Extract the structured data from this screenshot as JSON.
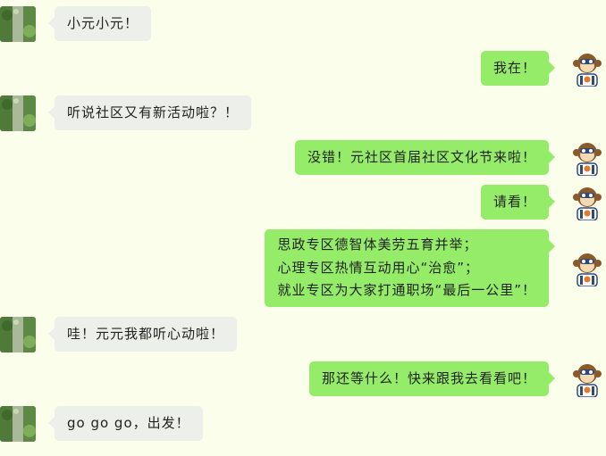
{
  "conversation": {
    "messages": [
      {
        "side": "left",
        "sender": "other",
        "text": "小元小元！"
      },
      {
        "side": "right",
        "sender": "self",
        "text": "我在！"
      },
      {
        "side": "left",
        "sender": "other",
        "text": "听说社区又有新活动啦？！"
      },
      {
        "side": "right",
        "sender": "self",
        "text": "没错！元社区首届社区文化节来啦！"
      },
      {
        "side": "right",
        "sender": "self",
        "text": "请看！"
      },
      {
        "side": "right",
        "sender": "self",
        "lines": [
          "思政专区德智体美劳五育并举；",
          "心理专区热情互动用心“治愈”；",
          "就业专区为大家打通职场“最后一公里”！"
        ]
      },
      {
        "side": "left",
        "sender": "other",
        "text": "哇！元元我都听心动啦！"
      },
      {
        "side": "right",
        "sender": "self",
        "text": "那还等什么！快来跟我去看看吧！"
      },
      {
        "side": "left",
        "sender": "other",
        "text": "go go go，出发！"
      }
    ]
  },
  "avatars": {
    "other": {
      "icon": "nature-photo-avatar",
      "colors": [
        "#4F7A3A",
        "#8DB26A",
        "#C9D9B0"
      ]
    },
    "self": {
      "icon": "monkey-astronaut-avatar",
      "colors": [
        "#8A5A2B",
        "#F3D9B4",
        "#2F4A7A",
        "#E07B2A"
      ]
    }
  },
  "theme": {
    "background": "#FCFEEC",
    "bubble_self": "#95EC69",
    "bubble_other": "#EDEFEA"
  }
}
